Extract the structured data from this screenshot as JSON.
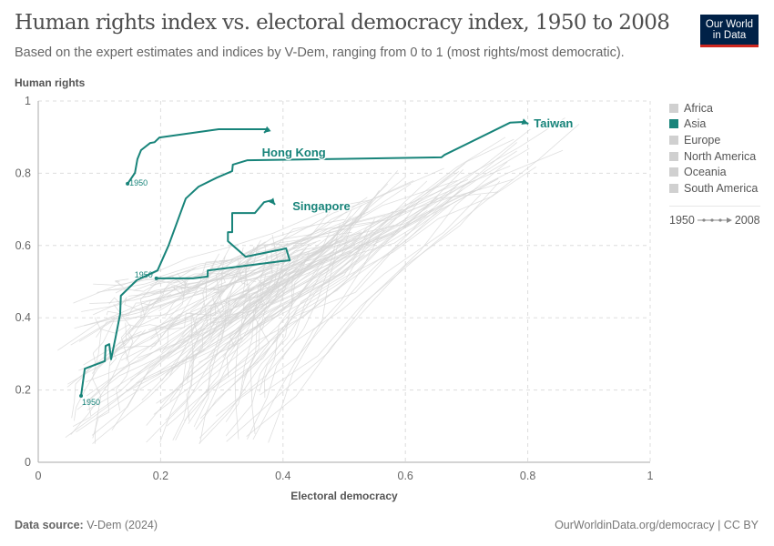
{
  "header": {
    "title": "Human rights index vs. electoral democracy index, 1950 to 2008",
    "subtitle": "Based on the expert estimates and indices by V-Dem, ranging from 0 to 1 (most rights/most democratic).",
    "logo_line1": "Our World",
    "logo_line2": "in Data"
  },
  "legend": {
    "items": [
      {
        "label": "Africa",
        "color": "#d0d0d0"
      },
      {
        "label": "Asia",
        "color": "#18847a"
      },
      {
        "label": "Europe",
        "color": "#d0d0d0"
      },
      {
        "label": "North America",
        "color": "#d0d0d0"
      },
      {
        "label": "Oceania",
        "color": "#d0d0d0"
      },
      {
        "label": "South America",
        "color": "#d0d0d0"
      }
    ],
    "timeline_start": "1950",
    "timeline_end": "2008"
  },
  "footer": {
    "source_label": "Data source:",
    "source_value": "V-Dem (2024)",
    "right": "OurWorldinData.org/democracy | CC BY"
  },
  "colors": {
    "highlight": "#18847a",
    "background_lines": "#d4d4d4",
    "grid": "#dddddd"
  },
  "chart_data": {
    "type": "scatter",
    "subtype": "connected-scatter",
    "title": "Human rights index vs. electoral democracy index, 1950 to 2008",
    "xlabel": "Electoral democracy",
    "ylabel": "Human rights",
    "xlim": [
      0,
      1
    ],
    "ylim": [
      0,
      1
    ],
    "xticks": [
      "0",
      "0.2",
      "0.4",
      "0.6",
      "0.8",
      "1"
    ],
    "yticks": [
      "0",
      "0.2",
      "0.4",
      "0.6",
      "0.8",
      "1"
    ],
    "xtick_values": [
      0,
      0.2,
      0.4,
      0.6,
      0.8,
      1
    ],
    "ytick_values": [
      0,
      0.2,
      0.4,
      0.6,
      0.8,
      1
    ],
    "grid": true,
    "legend_position": "right",
    "years": [
      1950,
      2008
    ],
    "highlighted_series": [
      {
        "name": "Taiwan",
        "start_label": "1950",
        "points": [
          [
            0.07,
            0.184
          ],
          [
            0.076,
            0.259
          ],
          [
            0.109,
            0.28
          ],
          [
            0.11,
            0.322
          ],
          [
            0.116,
            0.327
          ],
          [
            0.119,
            0.285
          ],
          [
            0.126,
            0.343
          ],
          [
            0.134,
            0.411
          ],
          [
            0.135,
            0.461
          ],
          [
            0.161,
            0.504
          ],
          [
            0.195,
            0.531
          ],
          [
            0.213,
            0.6
          ],
          [
            0.241,
            0.73
          ],
          [
            0.262,
            0.763
          ],
          [
            0.292,
            0.788
          ],
          [
            0.317,
            0.806
          ],
          [
            0.318,
            0.824
          ],
          [
            0.342,
            0.836
          ],
          [
            0.659,
            0.844
          ],
          [
            0.664,
            0.851
          ],
          [
            0.771,
            0.94
          ],
          [
            0.793,
            0.942
          ],
          [
            0.801,
            0.937
          ]
        ]
      },
      {
        "name": "Hong Kong",
        "start_label": "1950",
        "points": [
          [
            0.146,
            0.771
          ],
          [
            0.158,
            0.801
          ],
          [
            0.162,
            0.839
          ],
          [
            0.168,
            0.864
          ],
          [
            0.183,
            0.884
          ],
          [
            0.19,
            0.886
          ],
          [
            0.198,
            0.899
          ],
          [
            0.295,
            0.922
          ],
          [
            0.376,
            0.922
          ],
          [
            0.369,
            0.912
          ]
        ]
      },
      {
        "name": "Singapore",
        "start_label": "1950",
        "points": [
          [
            0.193,
            0.509
          ],
          [
            0.253,
            0.509
          ],
          [
            0.277,
            0.514
          ],
          [
            0.277,
            0.531
          ],
          [
            0.399,
            0.557
          ],
          [
            0.411,
            0.559
          ],
          [
            0.405,
            0.592
          ],
          [
            0.339,
            0.569
          ],
          [
            0.31,
            0.612
          ],
          [
            0.31,
            0.637
          ],
          [
            0.317,
            0.637
          ],
          [
            0.317,
            0.69
          ],
          [
            0.354,
            0.69
          ],
          [
            0.369,
            0.72
          ],
          [
            0.381,
            0.725
          ],
          [
            0.387,
            0.713
          ]
        ]
      }
    ],
    "background_series_note": "Many other countries shown as light gray trajectories, concentrated along diagonal from (0.05,0.1) to (0.9,0.95)"
  }
}
